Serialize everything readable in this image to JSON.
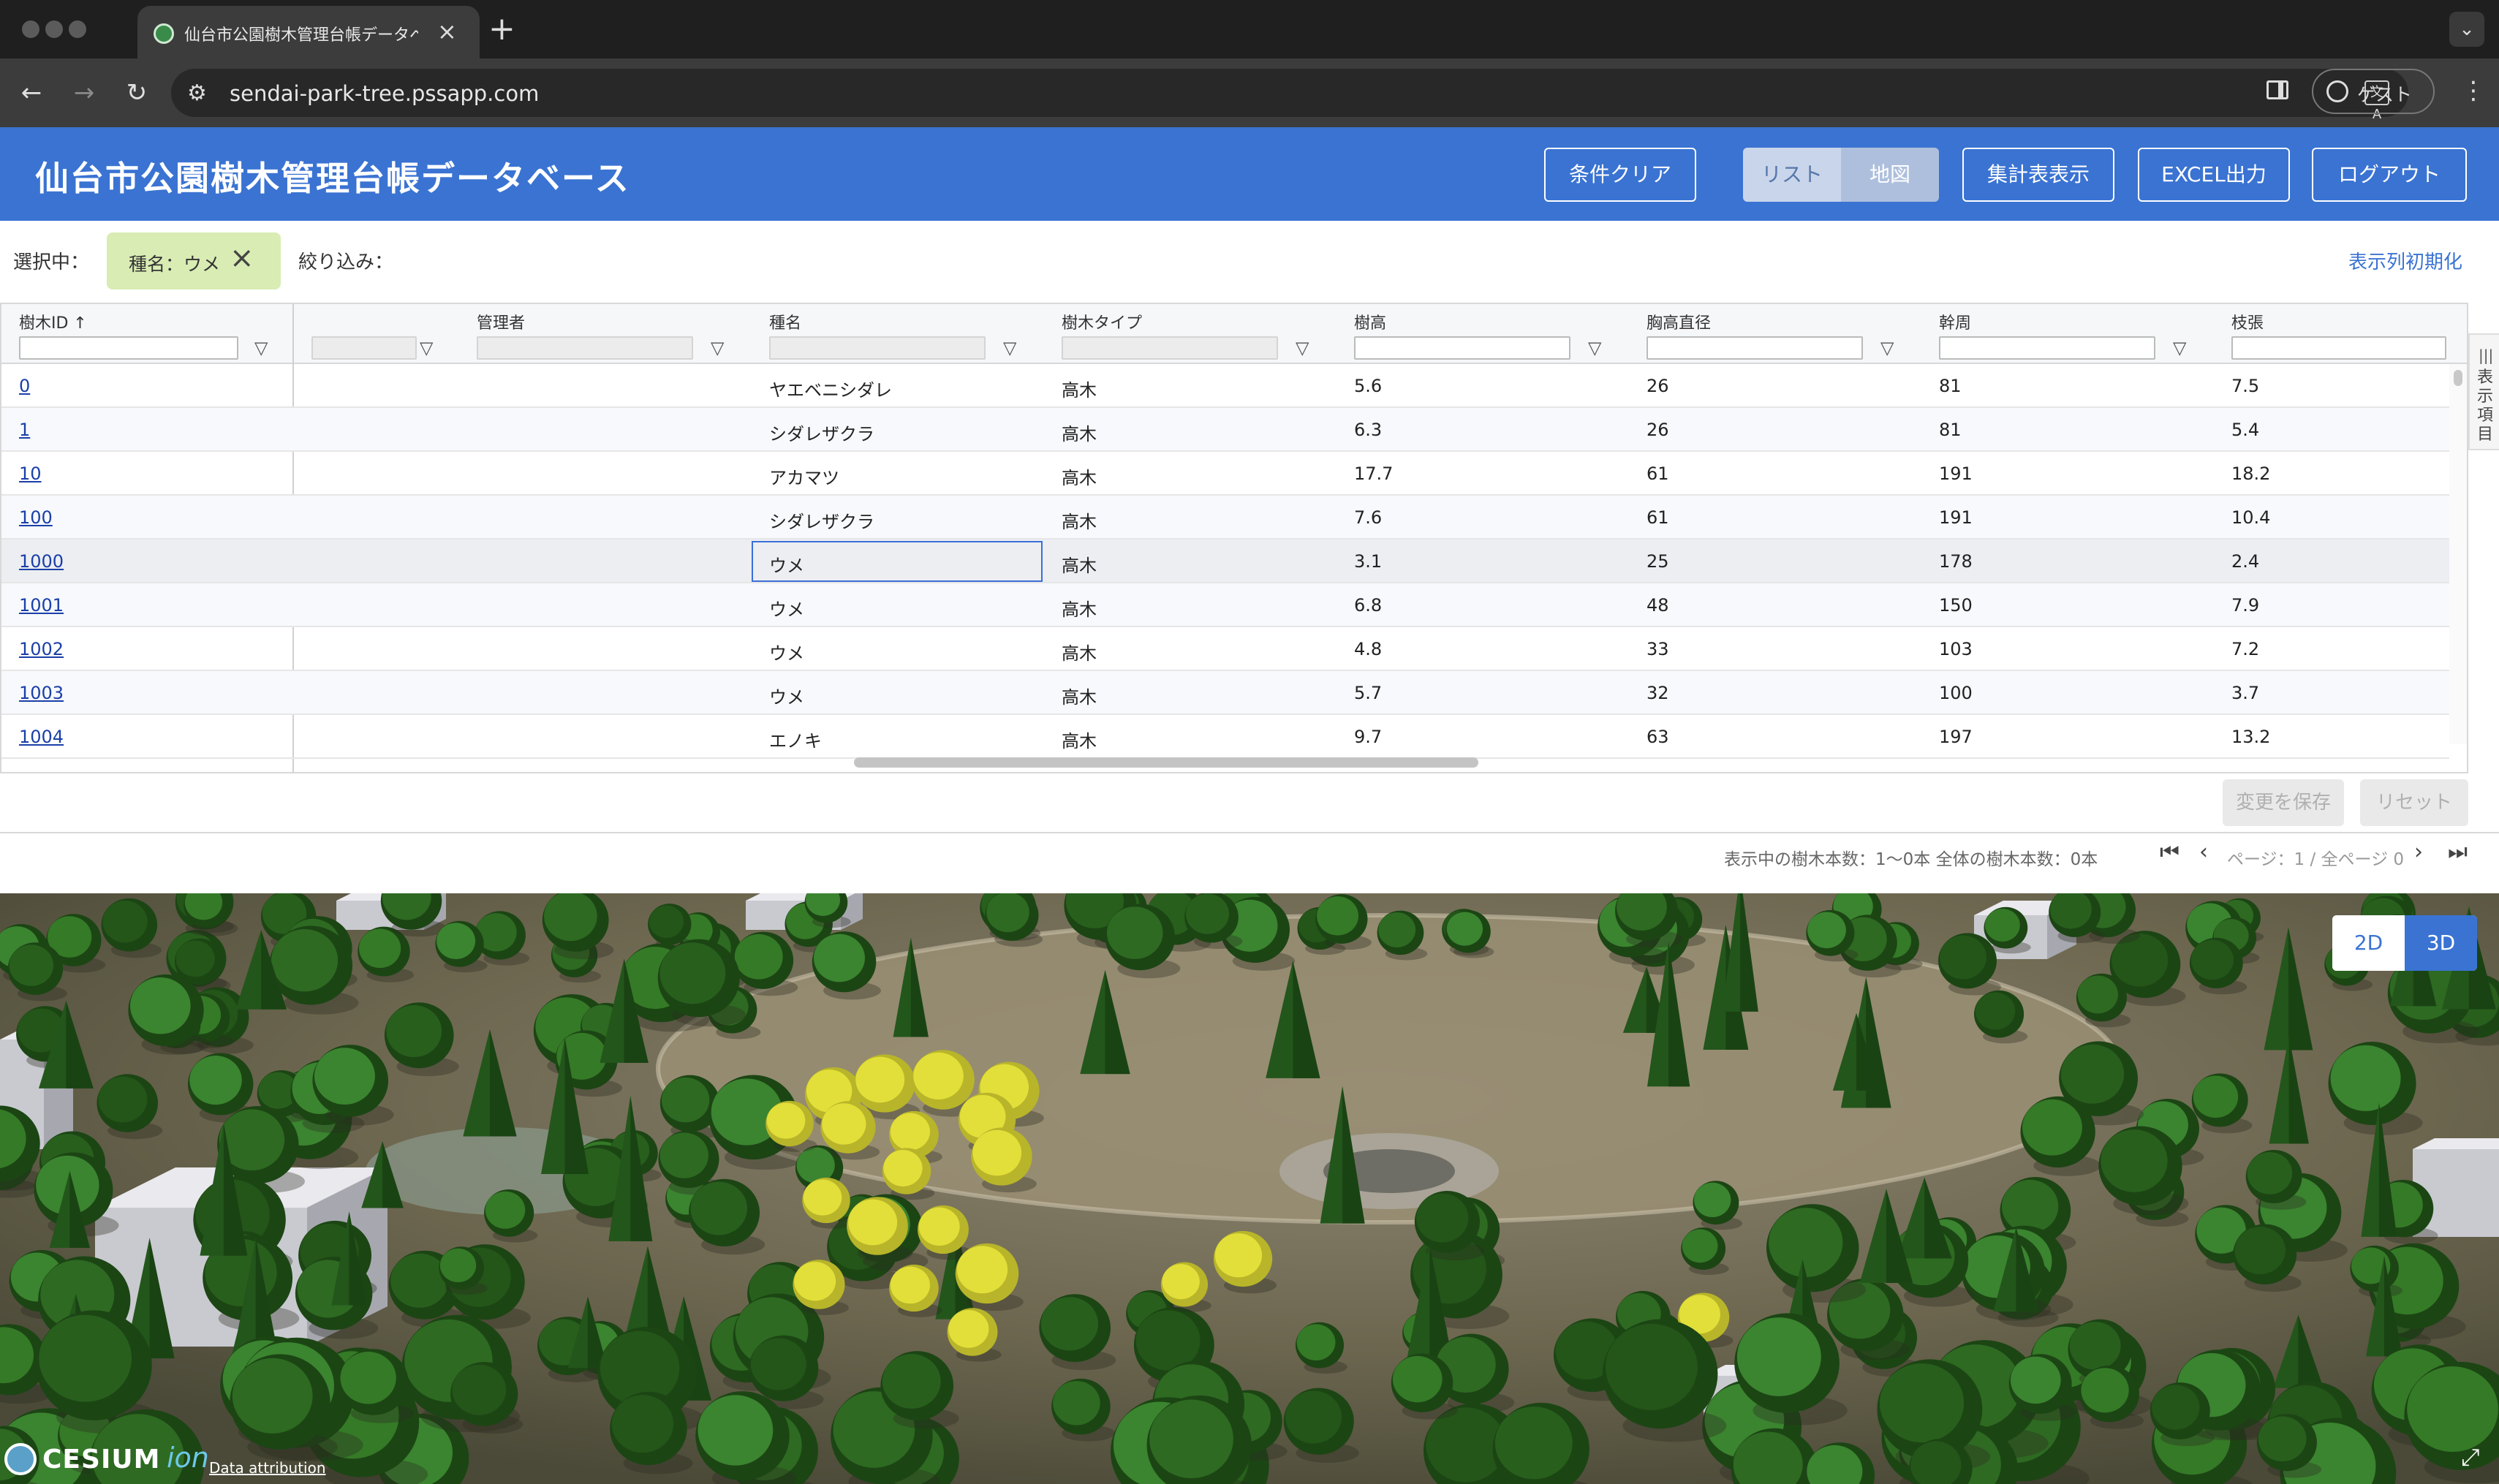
{
  "browser": {
    "tab_title": "仙台市公園樹木管理台帳データベース",
    "tab_close": "×",
    "new_tab": "+",
    "url": "sendai-park-tree.pssapp.com",
    "guest_label": "ゲスト",
    "translate_icon_text": "文A"
  },
  "header": {
    "title": "仙台市公園樹木管理台帳データベース",
    "buttons": {
      "clear": "条件クリア",
      "list": "リスト",
      "map": "地図",
      "summary": "集計表表示",
      "excel": "EXCEL出力",
      "logout": "ログアウト"
    },
    "active_view": "list"
  },
  "filterbar": {
    "selected_label": "選択中：",
    "chip_text": "種名：ウメ",
    "narrow_label": "絞り込み：",
    "reset_columns": "表示列初期化"
  },
  "grid": {
    "columns": [
      "樹木ID ↑",
      "",
      "管理者",
      "種名",
      "樹木タイプ",
      "樹高",
      "胸高直径",
      "幹周",
      "枝張"
    ],
    "rows": [
      {
        "id": "0",
        "admin": "",
        "species": "ヤエベニシダレ",
        "type": "高木",
        "height": "5.6",
        "dbh": "26",
        "girth": "81",
        "spread": "7.5"
      },
      {
        "id": "1",
        "admin": "",
        "species": "シダレザクラ",
        "type": "高木",
        "height": "6.3",
        "dbh": "26",
        "girth": "81",
        "spread": "5.4"
      },
      {
        "id": "10",
        "admin": "",
        "species": "アカマツ",
        "type": "高木",
        "height": "17.7",
        "dbh": "61",
        "girth": "191",
        "spread": "18.2"
      },
      {
        "id": "100",
        "admin": "",
        "species": "シダレザクラ",
        "type": "高木",
        "height": "7.6",
        "dbh": "61",
        "girth": "191",
        "spread": "10.4"
      },
      {
        "id": "1000",
        "admin": "",
        "species": "ウメ",
        "type": "高木",
        "height": "3.1",
        "dbh": "25",
        "girth": "178",
        "spread": "2.4"
      },
      {
        "id": "1001",
        "admin": "",
        "species": "ウメ",
        "type": "高木",
        "height": "6.8",
        "dbh": "48",
        "girth": "150",
        "spread": "7.9"
      },
      {
        "id": "1002",
        "admin": "",
        "species": "ウメ",
        "type": "高木",
        "height": "4.8",
        "dbh": "33",
        "girth": "103",
        "spread": "7.2"
      },
      {
        "id": "1003",
        "admin": "",
        "species": "ウメ",
        "type": "高木",
        "height": "5.7",
        "dbh": "32",
        "girth": "100",
        "spread": "3.7"
      },
      {
        "id": "1004",
        "admin": "",
        "species": "エノキ",
        "type": "高木",
        "height": "9.7",
        "dbh": "63",
        "girth": "197",
        "spread": "13.2"
      }
    ],
    "selected_row_index": 4,
    "side_tab_label": "表示項目",
    "save_button": "変更を保存",
    "reset_button": "リセット"
  },
  "pager": {
    "counts": "表示中の樹木本数：1〜0本 全体の樹木本数：0本",
    "page_text": "ページ：1 / 全ページ 0"
  },
  "map": {
    "btn_2d": "2D",
    "btn_3d": "3D",
    "active_mode": "3D",
    "logo_text": "CESIUM",
    "logo_suffix": "ion",
    "attribution": "Data attribution"
  },
  "colors": {
    "brand_blue": "#3a73d2",
    "chip_bg": "#d9ecb4",
    "tree_green": "#2f6b24",
    "tree_highlight": "#e7e43e"
  }
}
